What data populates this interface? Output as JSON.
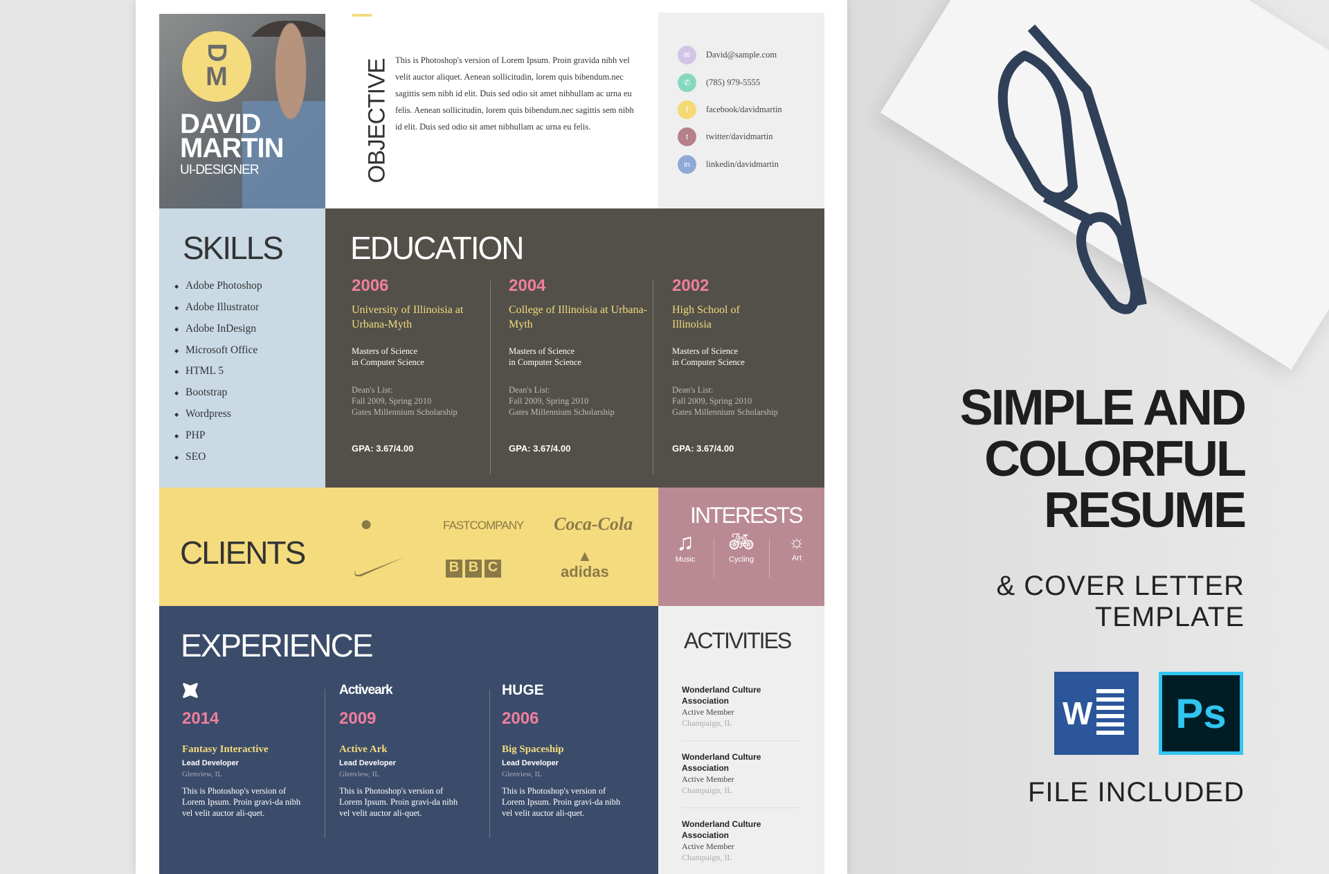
{
  "profile": {
    "initials_top": "D",
    "initials_bottom": "M",
    "first_name": "DAVID",
    "last_name": "MARTIN",
    "role": "UI-DESIGNER"
  },
  "objective": {
    "title": "OBJECTIVE",
    "text": "This is Photoshop's version  of Lorem Ipsum. Proin gravida nibh vel velit auctor aliquet. Aenean sollicitudin, lorem quis bibendum.nec sagittis sem nibh id elit. Duis sed odio sit amet nibhullam ac urna eu felis. Aenean sollicitudin, lorem quis bibendum.nec sagittis sem nibh id elit. Duis sed odio sit amet nibhullam ac urna eu felis."
  },
  "contact": [
    {
      "icon": "email-icon",
      "text": "David@sample.com",
      "color": "#d3c4e6",
      "glyph": "✉"
    },
    {
      "icon": "phone-icon",
      "text": "(785) 979-5555",
      "color": "#86d7c0",
      "glyph": "✆"
    },
    {
      "icon": "facebook-icon",
      "text": "facebook/davidmartin",
      "color": "#f4da74",
      "glyph": "f"
    },
    {
      "icon": "twitter-icon",
      "text": "twitter/davidmartin",
      "color": "#b57f8b",
      "glyph": "t"
    },
    {
      "icon": "linkedin-icon",
      "text": "linkedin/davidmartin",
      "color": "#8fa9d6",
      "glyph": "in"
    }
  ],
  "skills": {
    "title": "SKILLS",
    "items": [
      "Adobe Photoshop",
      "Adobe Illustrator",
      "Adobe InDesign",
      "Microsoft Office",
      "HTML 5",
      "Bootstrap",
      "Wordpress",
      "PHP",
      "SEO"
    ]
  },
  "education": {
    "title": "EDUCATION",
    "items": [
      {
        "year": "2006",
        "school": "University of Illinoisia at Urbana-Myth",
        "degree1": "Masters of Science",
        "degree2": "in Computer Science",
        "honors1": "Dean's List:",
        "honors2": "Fall 2009, Spring 2010",
        "honors3": "Gates Millennium Scholarship",
        "gpa": "GPA: 3.67/4.00"
      },
      {
        "year": "2004",
        "school": "College of Illinoisia at Urbana-Myth",
        "degree1": "Masters of Science",
        "degree2": "in Computer Science",
        "honors1": "Dean's List:",
        "honors2": "Fall 2009, Spring 2010",
        "honors3": "Gates Millennium Scholarship",
        "gpa": "GPA: 3.67/4.00"
      },
      {
        "year": "2002",
        "school": "High School of Illinoisia",
        "degree1": "Masters of Science",
        "degree2": "in Computer Science",
        "honors1": "Dean's List:",
        "honors2": "Fall 2009, Spring 2010",
        "honors3": "Gates Millennium Scholarship",
        "gpa": "GPA: 3.67/4.00"
      }
    ]
  },
  "clients": {
    "title": "CLIENTS",
    "logos": [
      "apple-logo",
      "FASTCOMPANY",
      "Coca-Cola",
      "nike-logo",
      "BBC",
      "adidas"
    ]
  },
  "interests": {
    "title": "INTERESTS",
    "items": [
      {
        "icon": "music-icon",
        "label": "Music"
      },
      {
        "icon": "bicycle-icon",
        "label": "Cycling"
      },
      {
        "icon": "lightbulb-icon",
        "label": "Art"
      }
    ]
  },
  "experience": {
    "title": "EXPERIENCE",
    "items": [
      {
        "company_logo": "fantasy-logo",
        "year": "2014",
        "company": "Fantasy Interactive",
        "role": "Lead Developer",
        "location": "Glenview, IL",
        "text": "This is Photoshop's version of Lorem Ipsum. Proin gravi-da nibh vel velit auctor ali-quet."
      },
      {
        "company_logo": "Activeark",
        "year": "2009",
        "company": "Active Ark",
        "role": "Lead Developer",
        "location": "Glenview, IL",
        "text": "This is Photoshop's version of Lorem Ipsum. Proin gravi-da nibh vel velit auctor ali-quet."
      },
      {
        "company_logo": "HUGE",
        "year": "2006",
        "company": "Big Spaceship",
        "role": "Lead Developer",
        "location": "Glenview, IL",
        "text": "This is Photoshop's version of Lorem Ipsum. Proin gravi-da nibh vel velit auctor ali-quet."
      }
    ]
  },
  "activities": {
    "title": "ACTIVITIES",
    "items": [
      {
        "name": "Wonderland Culture Association",
        "role": "Active Member",
        "location": "Champaign, IL"
      },
      {
        "name": "Wonderland Culture Association",
        "role": "Active Member",
        "location": "Champaign, IL"
      },
      {
        "name": "Wonderland Culture Association",
        "role": "Active Member",
        "location": "Champaign, IL"
      }
    ]
  },
  "promo": {
    "line1": "SIMPLE AND",
    "line2": "COLORFUL",
    "line3": "RESUME",
    "sub1": "& COVER LETTER",
    "sub2": "TEMPLATE",
    "word_letter": "W",
    "ps_letters": "Ps",
    "files": "FILE INCLUDED"
  },
  "colors": {
    "pink": "#ef7f9d",
    "yellow": "#f4db7d",
    "blue": "#3b4c6a",
    "charcoal": "#525049",
    "skills_bg": "#c9dae5",
    "interests_bg": "#ba8a94",
    "word": "#2b579a",
    "ps_bg": "#001d26",
    "ps_accent": "#31c5f0"
  }
}
